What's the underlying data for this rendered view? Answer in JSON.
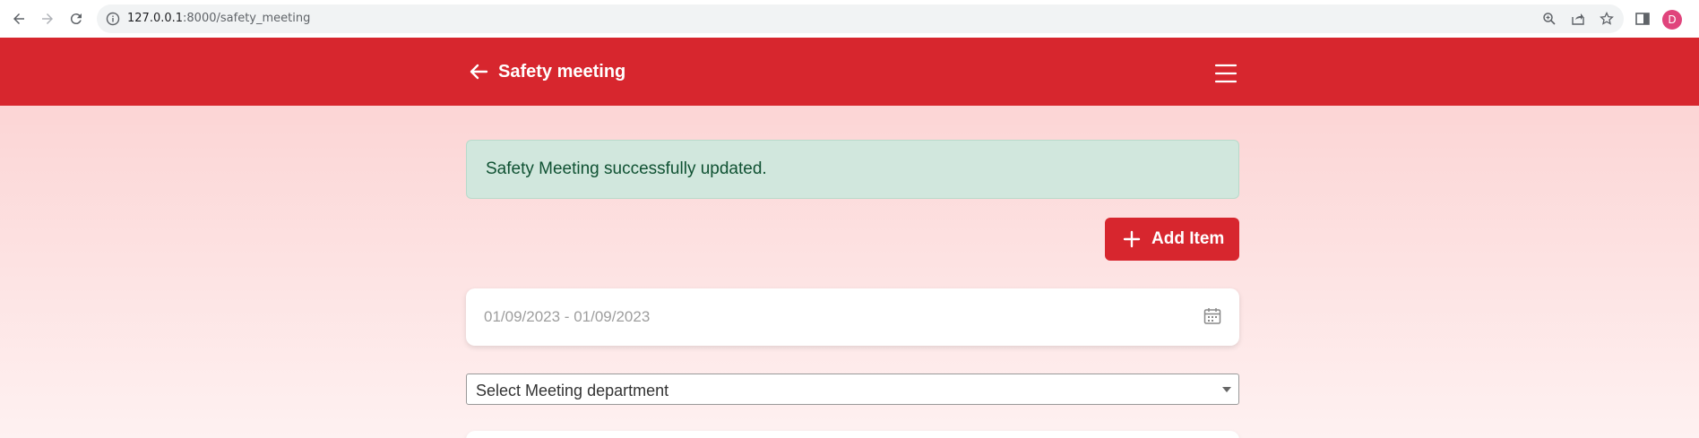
{
  "browser": {
    "url_host": "127.0.0.1",
    "url_rest": ":8000/safety_meeting",
    "profile_initial": "D"
  },
  "header": {
    "title": "Safety meeting"
  },
  "alert": {
    "message": "Safety Meeting successfully updated."
  },
  "actions": {
    "add_item_label": "Add Item"
  },
  "filters": {
    "date_range_placeholder": "01/09/2023 - 01/09/2023",
    "department_select": "Select Meeting department"
  },
  "colors": {
    "brand_red": "#d7262e",
    "alert_bg": "#d1e7dd",
    "alert_text": "#0f5132"
  }
}
